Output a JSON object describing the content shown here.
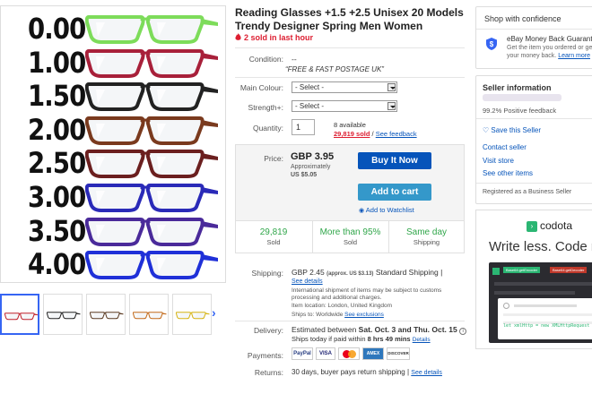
{
  "listing": {
    "title": "Reading Glasses +1.5 +2.5 Unisex 20 Models Trendy Designer Spring Men Women",
    "sold_last_hour": "2 sold in last hour",
    "accent_red": "#dd1e31",
    "link_blue": "#0654ba"
  },
  "gallery": {
    "powers": [
      "0.00",
      "1.00",
      "1.50",
      "2.00",
      "2.50",
      "3.00",
      "3.50",
      "4.00"
    ],
    "frame_colors": [
      "#7ddc5a",
      "#a8203a",
      "#222222",
      "#7a3a1e",
      "#6b1f1f",
      "#2a2ab8",
      "#4a2a9a",
      "#1f30d8"
    ],
    "thumbs": [
      "thumb-red-glasses",
      "thumb-black-glasses",
      "thumb-tortoise-glasses",
      "thumb-orange-glasses",
      "thumb-yellow-glasses"
    ],
    "next_icon": "chevron-right-icon"
  },
  "details": {
    "condition_label": "Condition:",
    "condition_value": "--",
    "condition_note": "“FREE & FAST POSTAGE UK”",
    "colour_label": "Main Colour:",
    "colour_value": "- Select -",
    "strength_label": "Strength+:",
    "strength_value": "- Select -",
    "quantity_label": "Quantity:",
    "quantity_value": "1",
    "available": "8 available",
    "sold_count": "29,819 sold",
    "separator": "/",
    "feedback_link": "See feedback"
  },
  "price": {
    "label": "Price:",
    "value": "GBP 3.95",
    "approx_label": "Approximately",
    "approx_value": "US $5.05",
    "buy_now": "Buy It Now",
    "add_to_cart": "Add to cart",
    "watchlist": "Add to Watchlist",
    "stats": [
      {
        "value": "29,819",
        "label": "Sold"
      },
      {
        "value": "More than 95%",
        "label": "Sold"
      },
      {
        "value": "Same day",
        "label": "Shipping"
      }
    ]
  },
  "shipping": {
    "label": "Shipping:",
    "cost": "GBP 2.45",
    "approx": "(approx. US $3.13)",
    "method": "Standard Shipping |",
    "details_link": "See details",
    "note": "International shipment of items may be subject to customs processing and additional charges.",
    "location": "Item location: London, United Kingdom",
    "ships_to": "Ships to: Worldwide",
    "exclusions_link": "See exclusions"
  },
  "delivery": {
    "label": "Delivery:",
    "estimated_prefix": "Estimated between",
    "dates": "Sat. Oct. 3 and Thu. Oct. 15",
    "ships_today_prefix": "Ships today if paid within",
    "time_left": "8 hrs 49 mins",
    "details_link": "Details"
  },
  "payments": {
    "label": "Payments:",
    "methods": [
      "PayPal",
      "VISA",
      "MC",
      "AMEX",
      "DISCOVER"
    ]
  },
  "returns": {
    "label": "Returns:",
    "text": "30 days, buyer pays return shipping |",
    "details_link": "See details"
  },
  "confidence": {
    "title": "Shop with confidence",
    "guarantee_title": "eBay Money Back Guarantee",
    "guarantee_text": "Get the item you ordered or get your money back.",
    "learn_more": "Learn more"
  },
  "seller": {
    "title": "Seller information",
    "positive": "99.2% Positive feedback",
    "save": "Save this Seller",
    "contact": "Contact seller",
    "visit": "Visit store",
    "other_items": "See other items",
    "registered": "Registered as a Business Seller"
  },
  "ad": {
    "brand": "codota",
    "headline": "Write less. Code more.",
    "tab1": "Base64.getEncoder",
    "tab2": "Base64.getDecoder",
    "code_line": "let xmlHttp = new XMLHttpRequest"
  }
}
